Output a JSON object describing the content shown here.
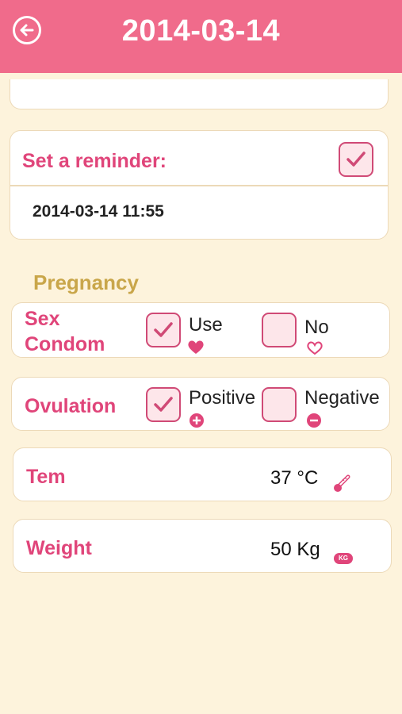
{
  "header": {
    "title": "2014-03-14"
  },
  "reminder": {
    "label": "Set a reminder:",
    "checked": true,
    "datetime": "2014-03-14 11:55"
  },
  "pregnancy": {
    "section_title": "Pregnancy",
    "sex_condom": {
      "label_line1": "Sex",
      "label_line2": "Condom",
      "option_use": "Use",
      "option_no": "No"
    },
    "ovulation": {
      "label": "Ovulation",
      "option_positive": "Positive",
      "option_negative": "Negative"
    },
    "temperature": {
      "label": "Tem",
      "value": "37 °C"
    },
    "weight": {
      "label": "Weight",
      "value": "50 Kg",
      "badge": "KG"
    }
  },
  "colors": {
    "header": "#f06b8b",
    "accent": "#e0457a",
    "section_title": "#c9a64a",
    "background": "#fdf3dc"
  }
}
